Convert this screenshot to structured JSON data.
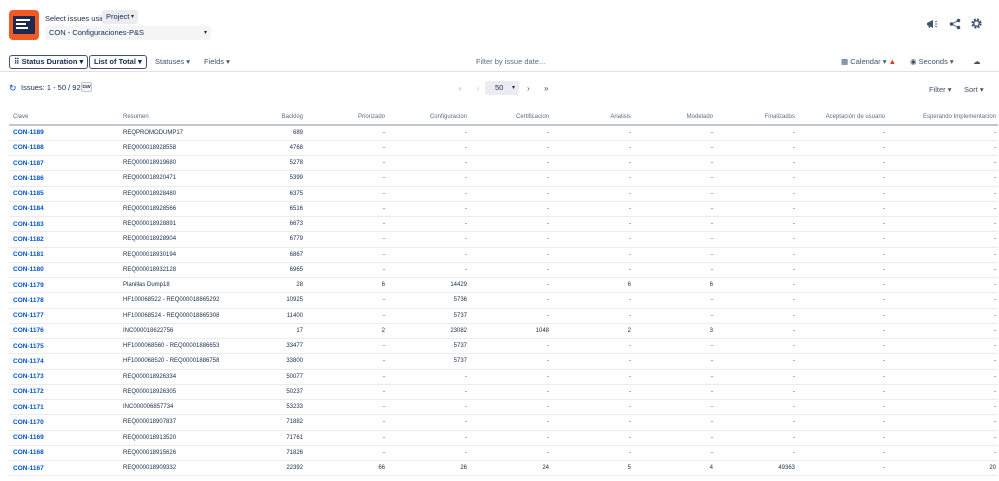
{
  "header": {
    "select_label": "Select issues using",
    "mode_button": "Project",
    "project_value": "CON - Configuraciones-P&S"
  },
  "toolbar": {
    "status_duration": "Status Duration",
    "list_of_total": "List of Total",
    "statuses": "Statuses",
    "fields": "Fields",
    "filter_date": "Filter by issue date...",
    "calendar": "Calendar",
    "seconds": "Seconds"
  },
  "info": {
    "issues": "Issues: 1 - 50 / 929",
    "csv": "csv",
    "per_page": "50",
    "filter": "Filter",
    "sort": "Sort"
  },
  "icons": {
    "refresh": "refresh-icon",
    "announce": "megaphone-icon",
    "share": "share-icon",
    "settings": "gear-icon",
    "warning": "warning-icon",
    "upload": "cloud-icon",
    "accent": "#0052cc",
    "warning_color": "#de350b",
    "logo_color": "#f15a24"
  },
  "table": {
    "headers": [
      "Clave",
      "Resumen",
      "Backlog",
      "Priorizado",
      "Configuracion",
      "Certificacion",
      "Analisis",
      "Modelado",
      "Finalizados",
      "Aceptación de usuario",
      "Esperando Implementacion"
    ],
    "rows": [
      [
        "CON-1189",
        "REQPROMODUMP17",
        "689",
        "-",
        "-",
        "-",
        "-",
        "-",
        "-",
        "-",
        "-"
      ],
      [
        "CON-1188",
        "REQ000018928558",
        "4768",
        "-",
        "-",
        "-",
        "-",
        "-",
        "-",
        "-",
        "-"
      ],
      [
        "CON-1187",
        "REQ000018919680",
        "5278",
        "-",
        "-",
        "-",
        "-",
        "-",
        "-",
        "-",
        "-"
      ],
      [
        "CON-1186",
        "REQ000018920471",
        "5399",
        "-",
        "-",
        "-",
        "-",
        "-",
        "-",
        "-",
        "-"
      ],
      [
        "CON-1185",
        "REQ000018928480",
        "6375",
        "-",
        "-",
        "-",
        "-",
        "-",
        "-",
        "-",
        "-"
      ],
      [
        "CON-1184",
        "REQ000018928566",
        "6516",
        "-",
        "-",
        "-",
        "-",
        "-",
        "-",
        "-",
        "-"
      ],
      [
        "CON-1183",
        "REQ000018928891",
        "6673",
        "-",
        "-",
        "-",
        "-",
        "-",
        "-",
        "-",
        "-"
      ],
      [
        "CON-1182",
        "REQ000018928904",
        "6779",
        "-",
        "-",
        "-",
        "-",
        "-",
        "-",
        "-",
        "-"
      ],
      [
        "CON-1181",
        "REQ000018930194",
        "6867",
        "-",
        "-",
        "-",
        "-",
        "-",
        "-",
        "-",
        "-"
      ],
      [
        "CON-1180",
        "REQ000018932128",
        "6965",
        "-",
        "-",
        "-",
        "-",
        "-",
        "-",
        "-",
        "-"
      ],
      [
        "CON-1179",
        "Planillas Dump18",
        "28",
        "6",
        "14429",
        "-",
        "6",
        "6",
        "-",
        "-",
        "-"
      ],
      [
        "CON-1178",
        "HF100068522 - REQ000018865292",
        "10925",
        "-",
        "5736",
        "-",
        "-",
        "-",
        "-",
        "-",
        "-"
      ],
      [
        "CON-1177",
        "HF100068524 - REQ000018865308",
        "11400",
        "-",
        "5737",
        "-",
        "-",
        "-",
        "-",
        "-",
        "-"
      ],
      [
        "CON-1176",
        "INC000018622756",
        "17",
        "2",
        "23082",
        "1048",
        "2",
        "3",
        "-",
        "-",
        "-"
      ],
      [
        "CON-1175",
        "HF1000068560 - REQ000018866531",
        "33477",
        "-",
        "5737",
        "-",
        "-",
        "-",
        "-",
        "-",
        "-"
      ],
      [
        "CON-1174",
        "HF1000068520 - REQ000018867585",
        "33800",
        "-",
        "5737",
        "-",
        "-",
        "-",
        "-",
        "-",
        "-"
      ],
      [
        "CON-1173",
        "REQ000018926334",
        "50077",
        "-",
        "-",
        "-",
        "-",
        "-",
        "-",
        "-",
        "-"
      ],
      [
        "CON-1172",
        "REQ000018926305",
        "50237",
        "-",
        "-",
        "-",
        "-",
        "-",
        "-",
        "-",
        "-"
      ],
      [
        "CON-1171",
        "INC000006857734",
        "53233",
        "-",
        "-",
        "-",
        "-",
        "-",
        "-",
        "-",
        "-"
      ],
      [
        "CON-1170",
        "REQ000018907837",
        "71882",
        "-",
        "-",
        "-",
        "-",
        "-",
        "-",
        "-",
        "-"
      ],
      [
        "CON-1169",
        "REQ000018913520",
        "71761",
        "-",
        "-",
        "-",
        "-",
        "-",
        "-",
        "-",
        "-"
      ],
      [
        "CON-1168",
        "REQ000018915626",
        "71826",
        "-",
        "-",
        "-",
        "-",
        "-",
        "-",
        "-",
        "-"
      ],
      [
        "CON-1167",
        "REQ000018909332",
        "22392",
        "66",
        "26",
        "24",
        "5",
        "4",
        "49363",
        "-",
        "20"
      ]
    ]
  }
}
